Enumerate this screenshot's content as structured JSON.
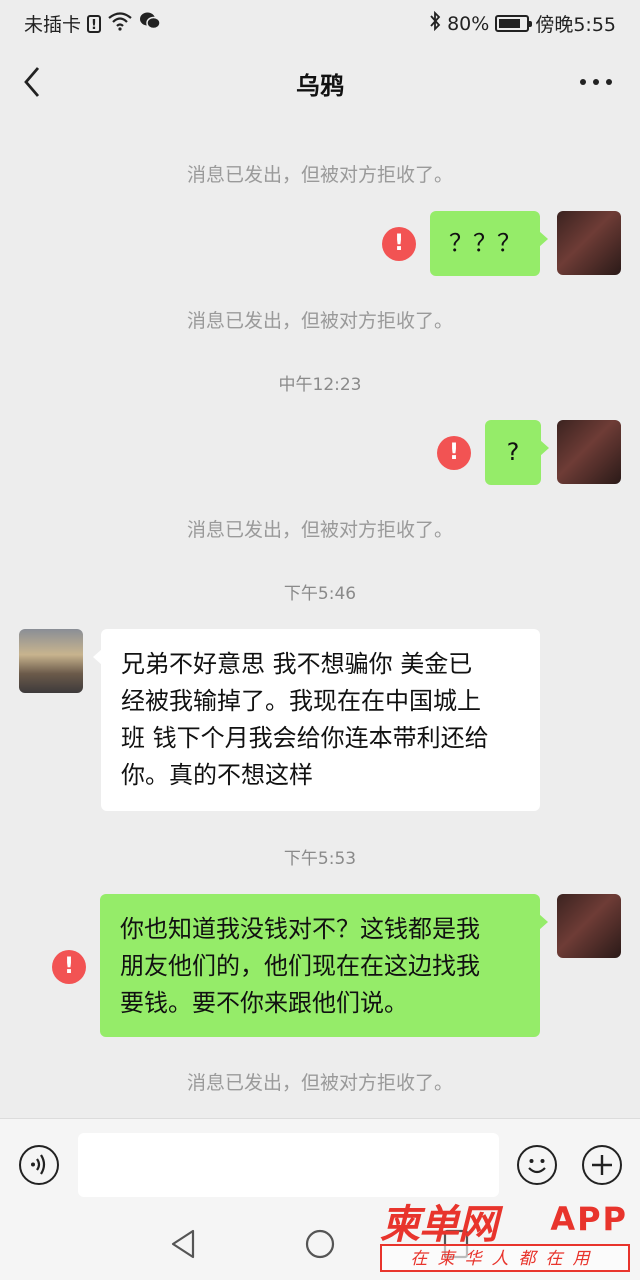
{
  "status_bar": {
    "carrier": "未插卡",
    "battery": "80%",
    "battery_level": 0.8,
    "time": "傍晚5:55"
  },
  "header": {
    "title": "乌鸦"
  },
  "messages": {
    "sys_1": "消息已发出，但被对方拒收了。",
    "me_1": "？？？",
    "sys_2": "消息已发出，但被对方拒收了。",
    "time_1": "中午12:23",
    "me_2": "?",
    "sys_3": "消息已发出，但被对方拒收了。",
    "time_2": "下午5:46",
    "them_1_line1": "兄弟不好意思 我不想骗你 美金已",
    "them_1_line2": "经被我输掉了。我现在在中国城上",
    "them_1_line3": "班 钱下个月我会给你连本带利还给",
    "them_1_line4": "你。真的不想这样",
    "time_3": "下午5:53",
    "me_3_line1": "你也知道我没钱对不？这钱都是我",
    "me_3_line2": "朋友他们的，他们现在在这边找我",
    "me_3_line3": "要钱。要不你来跟他们说。",
    "sys_4": "消息已发出，但被对方拒收了。",
    "error_mark": "!"
  },
  "input_bar": {
    "value": ""
  },
  "watermark": {
    "brand": "柬单网",
    "app": "APP",
    "tagline": "在柬华人都在用"
  }
}
